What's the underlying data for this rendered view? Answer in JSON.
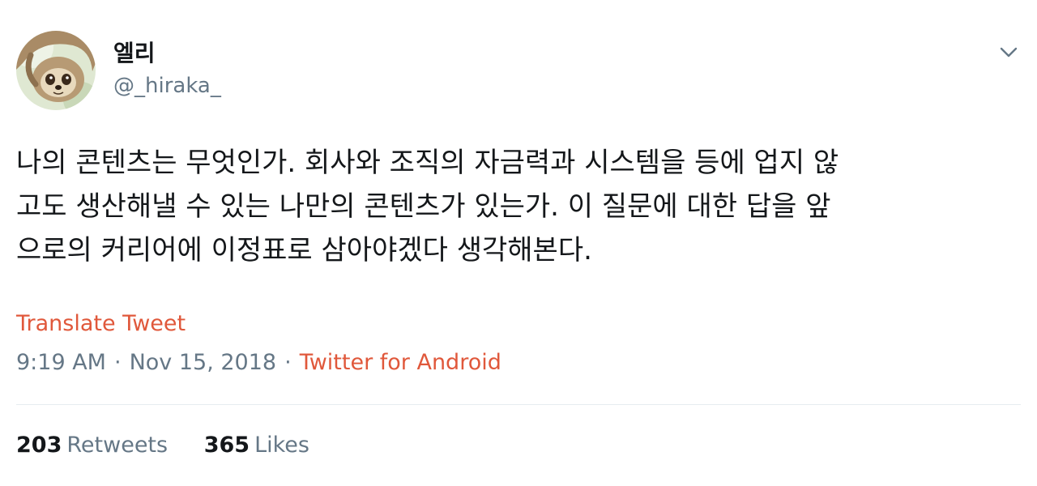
{
  "user": {
    "display_name": "엘리",
    "handle": "@_hiraka_",
    "avatar_icon": "sloth-avatar"
  },
  "tweet": {
    "text": "나의 콘텐츠는 무엇인가. 회사와 조직의 자금력과 시스템을 등에 업지 않\n고도 생산해낼 수 있는 나만의 콘텐츠가 있는가. 이 질문에 대한 답을 앞\n으로의 커리어에 이정표로 삼아야겠다 생각해본다.",
    "translate_label": "Translate Tweet",
    "time": "9:19 AM",
    "separator": "·",
    "date": "Nov 15, 2018",
    "source": "Twitter for Android"
  },
  "stats": {
    "retweets_count": "203",
    "retweets_label": "Retweets",
    "likes_count": "365",
    "likes_label": "Likes"
  },
  "colors": {
    "accent": "#e0583b",
    "muted": "#657786",
    "text": "#14171a",
    "divider": "#e6ecf0"
  },
  "icons": {
    "menu": "chevron-down-icon"
  }
}
